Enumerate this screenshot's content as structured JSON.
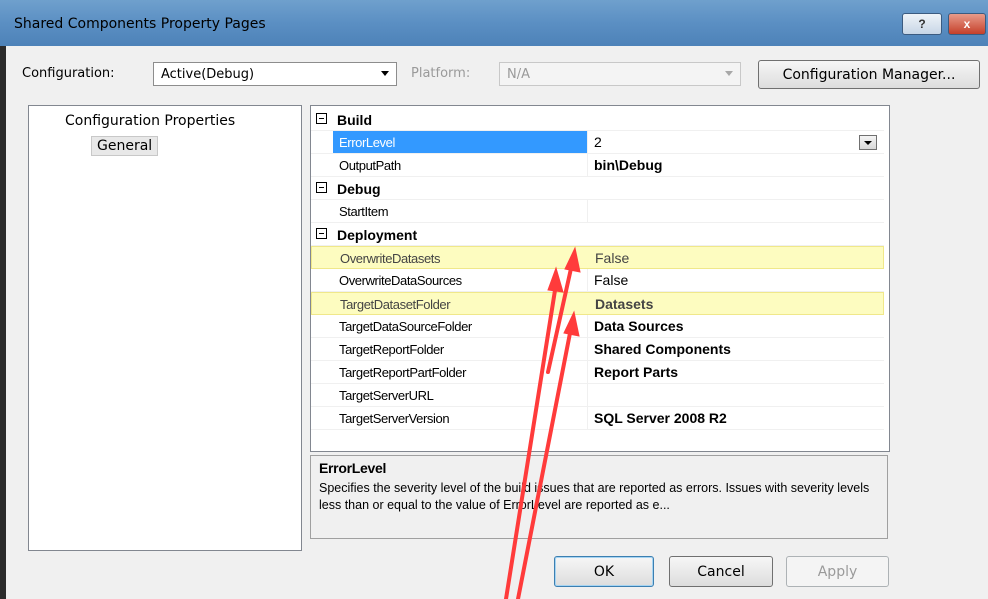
{
  "window": {
    "title": "Shared Components Property Pages",
    "help_label": "?",
    "close_label": "x"
  },
  "config": {
    "configuration_label": "Configuration:",
    "configuration_value": "Active(Debug)",
    "platform_label": "Platform:",
    "platform_value": "N/A",
    "manager_button": "Configuration Manager..."
  },
  "tree": {
    "root": "Configuration Properties",
    "child": "General"
  },
  "grid": {
    "categories": {
      "build": "Build",
      "debug": "Debug",
      "deployment": "Deployment"
    },
    "build": [
      {
        "name": "ErrorLevel",
        "value": "2"
      },
      {
        "name": "OutputPath",
        "value": "bin\\Debug"
      }
    ],
    "debug": [
      {
        "name": "StartItem",
        "value": ""
      }
    ],
    "deployment": [
      {
        "name": "OverwriteDatasets",
        "value": "False"
      },
      {
        "name": "OverwriteDataSources",
        "value": "False"
      },
      {
        "name": "TargetDatasetFolder",
        "value": "Datasets"
      },
      {
        "name": "TargetDataSourceFolder",
        "value": "Data Sources"
      },
      {
        "name": "TargetReportFolder",
        "value": "Shared Components"
      },
      {
        "name": "TargetReportPartFolder",
        "value": "Report Parts"
      },
      {
        "name": "TargetServerURL",
        "value": ""
      },
      {
        "name": "TargetServerVersion",
        "value": "SQL Server 2008 R2"
      }
    ]
  },
  "description": {
    "title": "ErrorLevel",
    "text": "Specifies the severity level of the build issues that are reported as errors. Issues with severity levels less than or equal to the value of ErrorLevel are reported as e..."
  },
  "buttons": {
    "ok": "OK",
    "cancel": "Cancel",
    "apply": "Apply"
  },
  "colors": {
    "selection": "#3399ff",
    "highlight": "#fdfcc0",
    "annotation_arrow": "#ff3b3b"
  }
}
